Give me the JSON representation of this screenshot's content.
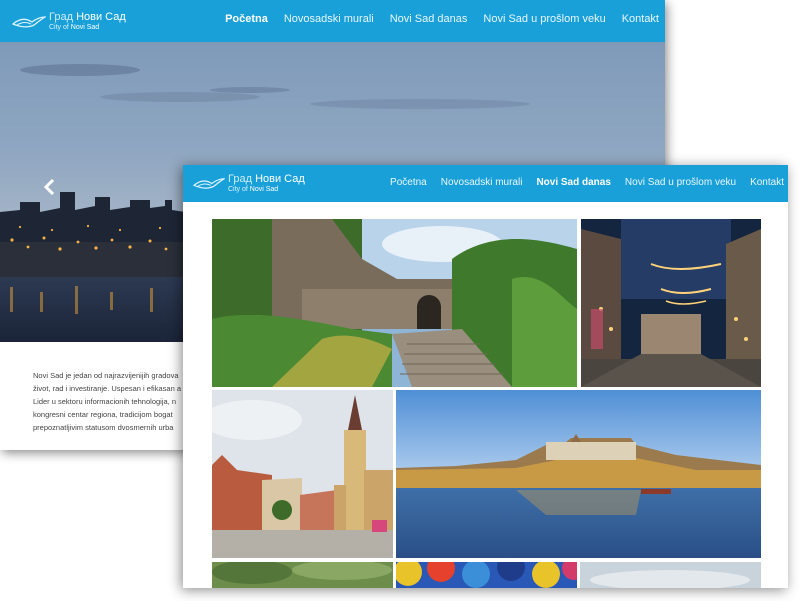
{
  "site": {
    "logo_line1_a": "Град",
    "logo_line1_b": "Нови Сад",
    "logo_line2_a": "City of",
    "logo_line2_b": "Novi Sad",
    "accent_color": "#1aa0d8"
  },
  "nav": {
    "items": [
      "Početna",
      "Novosadski murali",
      "Novi Sad danas",
      "Novi Sad u prošlom veku",
      "Kontakt"
    ]
  },
  "back_page": {
    "active_nav_index": 0,
    "hero_prev_icon": "chevron-left-icon",
    "intro_lines": [
      "Novi Sad je jedan od najrazvijenijih gradova",
      "život, rad i investiranje. Uspesan i efikasan a",
      "Lider u sektoru informacionih tehnologija, n",
      "kongresni centar regiona, tradicijom bogat",
      "prepoznatljivim statusom dvosmernih urba"
    ]
  },
  "front_page": {
    "active_nav_index": 2,
    "gallery_images": [
      "petrovaradin-fortress-stairs",
      "night-street-lights",
      "cathedral-square",
      "danube-river-fortress",
      "park-trees",
      "colorful-umbrellas",
      "cloudy-sky"
    ]
  }
}
